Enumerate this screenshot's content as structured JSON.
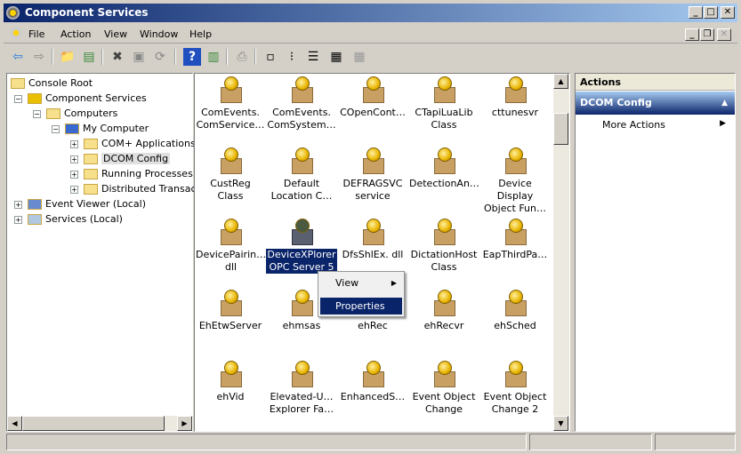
{
  "window": {
    "title": "Component Services",
    "icon": "component-services-icon"
  },
  "menubar": [
    "File",
    "Action",
    "View",
    "Window",
    "Help"
  ],
  "toolbar": [
    {
      "name": "back",
      "glyph": "⇦",
      "color": "#2a7ad8"
    },
    {
      "name": "forward",
      "glyph": "⇨",
      "color": "#888"
    },
    {
      "name": "up-folder",
      "glyph": "📁",
      "color": "#c8a000"
    },
    {
      "name": "show-hide-tree",
      "glyph": "▤",
      "color": "#3a8a3a"
    },
    {
      "name": "delete",
      "glyph": "✖",
      "color": "#444"
    },
    {
      "name": "properties",
      "glyph": "▣",
      "color": "#888"
    },
    {
      "name": "refresh",
      "glyph": "⟳",
      "color": "#888"
    },
    {
      "name": "help",
      "glyph": "?",
      "color": "#fff"
    },
    {
      "name": "show-hide-action-pane",
      "glyph": "▥",
      "color": "#3a8a3a"
    },
    {
      "name": "export",
      "glyph": "⎙",
      "color": "#888"
    },
    {
      "name": "large-icons",
      "glyph": "▫",
      "color": "#000"
    },
    {
      "name": "small-icons",
      "glyph": "⁝",
      "color": "#000"
    },
    {
      "name": "list-view",
      "glyph": "☰",
      "color": "#000"
    },
    {
      "name": "detail-view",
      "glyph": "▦",
      "color": "#000"
    },
    {
      "name": "status-view",
      "glyph": "▦",
      "color": "#999"
    }
  ],
  "tree": [
    {
      "label": "Console Root",
      "level": 0,
      "exp": "",
      "icon": "folder"
    },
    {
      "label": "Component Services",
      "level": 1,
      "exp": "−",
      "icon": "component-services"
    },
    {
      "label": "Computers",
      "level": 2,
      "exp": "−",
      "icon": "folder"
    },
    {
      "label": "My Computer",
      "level": 3,
      "exp": "−",
      "icon": "computer"
    },
    {
      "label": "COM+ Applications",
      "level": 4,
      "exp": "+",
      "icon": "folder"
    },
    {
      "label": "DCOM Config",
      "level": 4,
      "exp": "+",
      "icon": "folder",
      "selected": true
    },
    {
      "label": "Running Processes",
      "level": 4,
      "exp": "+",
      "icon": "folder"
    },
    {
      "label": "Distributed Transac",
      "level": 4,
      "exp": "+",
      "icon": "folder"
    },
    {
      "label": "Event Viewer (Local)",
      "level": 0.5,
      "exp": "+",
      "icon": "event-viewer"
    },
    {
      "label": "Services (Local)",
      "level": 0.5,
      "exp": "+",
      "icon": "services"
    }
  ],
  "items": [
    [
      "ComEvents.",
      "ComService…"
    ],
    [
      "ComEvents.",
      "ComSystem…"
    ],
    [
      "COpenCont…"
    ],
    [
      "CTapiLuaLib",
      "Class"
    ],
    [
      "cttunesvr"
    ],
    [
      "CustReg Class"
    ],
    [
      "Default",
      "Location C…"
    ],
    [
      "DEFRAGSVC",
      "service"
    ],
    [
      "DetectionAn…"
    ],
    [
      "Device Display",
      "Object Fun…"
    ],
    [
      "DevicePairin…",
      "dll"
    ],
    [
      "DeviceXPlorer",
      "OPC Server 5"
    ],
    [
      "DfsShlEx. dll"
    ],
    [
      "DictationHost",
      "Class"
    ],
    [
      "EapThirdPa…"
    ],
    [
      "EhEtwServer"
    ],
    [
      "ehmsas"
    ],
    [
      "ehRec"
    ],
    [
      "ehRecvr"
    ],
    [
      "ehSched"
    ],
    [
      "ehVid"
    ],
    [
      "Elevated-U…",
      "Explorer Fa…"
    ],
    [
      "EnhancedS…"
    ],
    [
      "Event Object",
      "Change"
    ],
    [
      "Event Object",
      "Change 2"
    ]
  ],
  "selected_item": 11,
  "context_menu": {
    "view": "View",
    "properties": "Properties"
  },
  "actions": {
    "header": "Actions",
    "section": "DCOM Config",
    "more": "More Actions"
  },
  "colors": {
    "accent": "#0a246a",
    "title_end": "#a6caf0"
  }
}
